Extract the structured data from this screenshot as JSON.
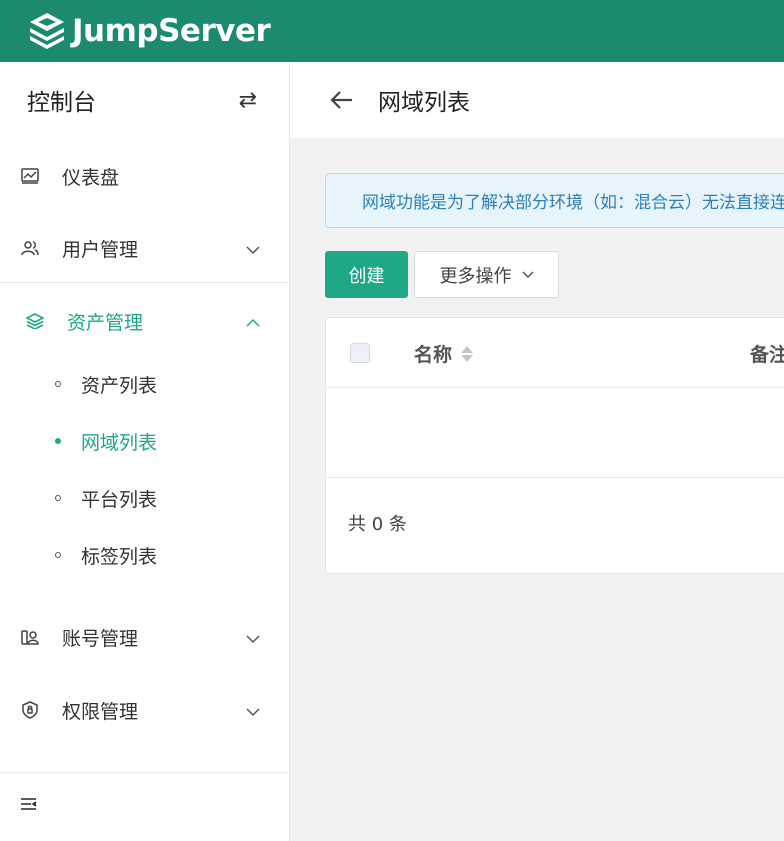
{
  "brand": {
    "name": "JumpServer"
  },
  "sidebar": {
    "title": "控制台",
    "items": [
      {
        "label": "仪表盘",
        "icon": "dashboard-icon"
      },
      {
        "label": "用户管理",
        "icon": "users-icon"
      },
      {
        "label": "资产管理",
        "icon": "layers-icon"
      },
      {
        "label": "账号管理",
        "icon": "account-icon"
      },
      {
        "label": "权限管理",
        "icon": "shield-icon"
      }
    ],
    "subitems": [
      {
        "label": "资产列表"
      },
      {
        "label": "网域列表"
      },
      {
        "label": "平台列表"
      },
      {
        "label": "标签列表"
      }
    ]
  },
  "page": {
    "title": "网域列表",
    "alert": "网域功能是为了解决部分环境（如：混合云）无法直接连接"
  },
  "toolbar": {
    "create": "创建",
    "more": "更多操作"
  },
  "table": {
    "columns": [
      "名称",
      "备注"
    ],
    "total": "共 0 条"
  },
  "colors": {
    "brand": "#1b8a6e",
    "accent": "#1ea886",
    "alert_text": "#2b7fc1"
  }
}
